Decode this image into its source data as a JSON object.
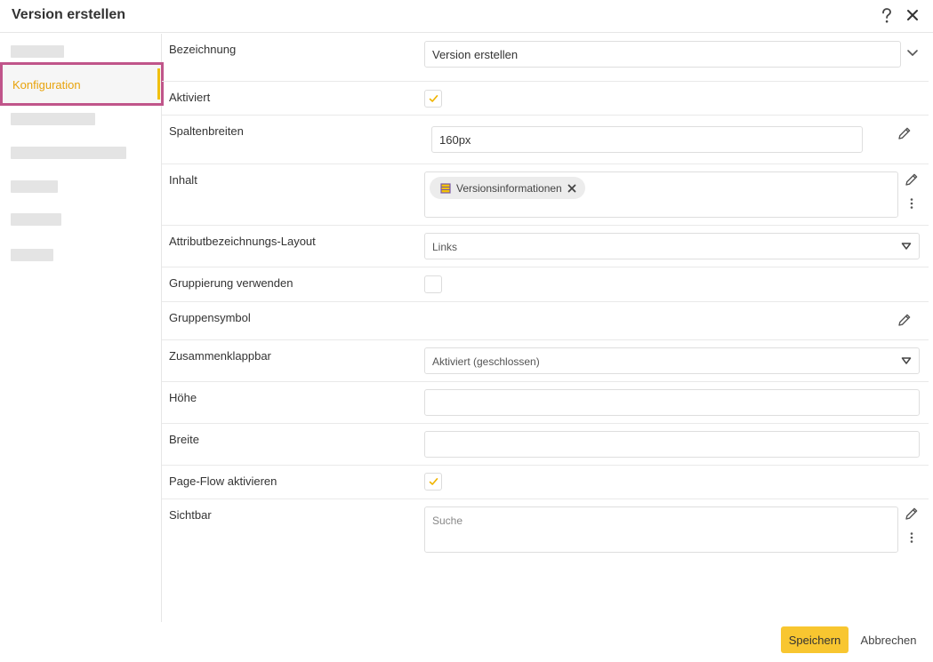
{
  "dialog": {
    "title": "Version erstellen"
  },
  "sidebar": {
    "active_item": "Konfiguration"
  },
  "form": {
    "bezeichnung": {
      "label": "Bezeichnung",
      "value": "Version erstellen"
    },
    "aktiviert": {
      "label": "Aktiviert",
      "checked": true
    },
    "spaltenbreiten": {
      "label": "Spaltenbreiten",
      "value": "160px"
    },
    "inhalt": {
      "label": "Inhalt",
      "chip": "Versionsinformationen"
    },
    "layout": {
      "label": "Attributbezeichnungs-Layout",
      "value": "Links"
    },
    "gruppierung": {
      "label": "Gruppierung verwenden",
      "checked": false
    },
    "gruppensymbol": {
      "label": "Gruppensymbol"
    },
    "zusammenklappbar": {
      "label": "Zusammenklappbar",
      "value": "Aktiviert (geschlossen)"
    },
    "hoehe": {
      "label": "Höhe",
      "value": ""
    },
    "breite": {
      "label": "Breite",
      "value": ""
    },
    "pageflow": {
      "label": "Page-Flow aktivieren",
      "checked": true
    },
    "sichtbar": {
      "label": "Sichtbar",
      "placeholder": "Suche"
    }
  },
  "footer": {
    "save_label": "Speichern",
    "cancel_label": "Abbrechen"
  },
  "colors": {
    "accent": "#f8c630",
    "active_text": "#e8a30c",
    "highlight_border": "#c0558a",
    "check": "#f0b400"
  },
  "icons": [
    "help-icon",
    "close-icon",
    "chevron-down-icon",
    "pencil-icon",
    "kebab-menu-icon",
    "dropdown-triangle-icon",
    "checkmark-icon",
    "element-icon",
    "remove-icon"
  ]
}
